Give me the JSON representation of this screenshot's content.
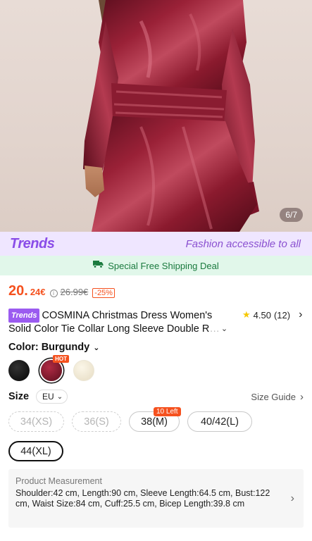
{
  "hero": {
    "image_counter": "6/7"
  },
  "trends_banner": {
    "logo": "Trends",
    "tagline": "Fashion accessible to all"
  },
  "shipping": {
    "text": "Special Free Shipping Deal",
    "icon": "truck-icon"
  },
  "price": {
    "main": "20.",
    "cents": "24€",
    "original": "26.99€",
    "discount": "-25%"
  },
  "product": {
    "tag": "Trends",
    "title_line1": "COSMINA Christmas Dress Women's",
    "title_line2": "Solid Color Tie Collar Long Sleeve Double R",
    "rating": "4.50",
    "review_count": "(12)"
  },
  "color": {
    "label": "Color: Burgundy",
    "hot_badge": "HOT",
    "options": [
      {
        "name": "black",
        "hex": "#0a0a0a"
      },
      {
        "name": "burgundy",
        "hex": "#7a1428"
      },
      {
        "name": "cream",
        "hex": "#f1ead8"
      }
    ]
  },
  "size": {
    "label": "Size",
    "region": "EU",
    "guide": "Size Guide",
    "options": [
      {
        "label": "34(XS)",
        "state": "disabled"
      },
      {
        "label": "36(S)",
        "state": "disabled"
      },
      {
        "label": "38(M)",
        "state": "available",
        "badge": "10 Left"
      },
      {
        "label": "40/42(L)",
        "state": "available"
      },
      {
        "label": "44(XL)",
        "state": "selected"
      }
    ]
  },
  "measurement": {
    "title": "Product Measurement",
    "text": "Shoulder:42 cm, Length:90 cm, Sleeve Length:64.5 cm, Bust:122 cm, Waist Size:84 cm, Cuff:25.5 cm, Bicep Length:39.8 cm"
  },
  "colors": {
    "price": "#f5511e",
    "trends_purple": "#8a4de8",
    "ship_green": "#1a7a3e"
  }
}
